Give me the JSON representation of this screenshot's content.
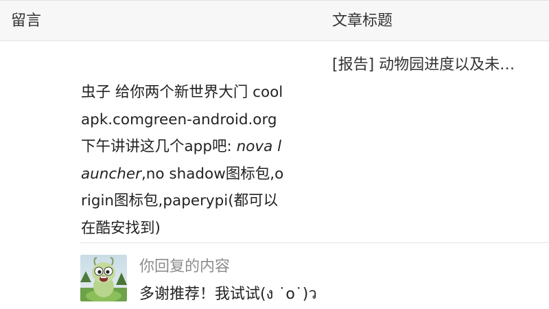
{
  "table": {
    "header": {
      "comment_col": "留言",
      "title_col": "文章标题"
    },
    "row": {
      "article_title": "[报告] 动物园进度以及未…",
      "comment": {
        "part1": "虫子 给你两个新世界大门 coolapk.comgreen-android.org 下午讲讲这几个app吧: ",
        "italic": "nova launcher",
        "part2": ",no shadow图标包,origin图标包,paperypi(都可以在酷安找到)"
      },
      "reply": {
        "label": "你回复的内容",
        "text": "多谢推荐！我试试(ง ˙o˙)ว"
      }
    }
  },
  "colors": {
    "header_bg": "#f7f7f7",
    "divider": "#e3e3e3",
    "muted_text": "#8c8c8c"
  }
}
